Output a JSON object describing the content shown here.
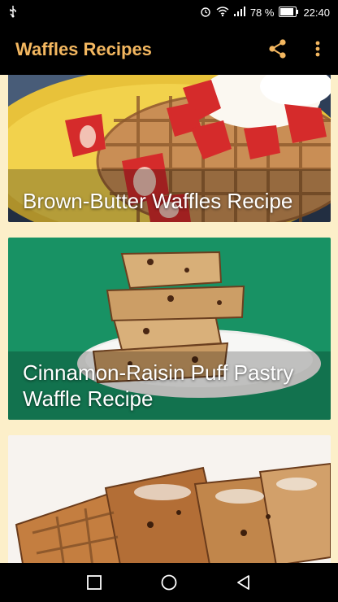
{
  "status": {
    "battery_percent": "78 %",
    "time": "22:40"
  },
  "app": {
    "title": "Waffles Recipes"
  },
  "recipes": [
    {
      "title": "Brown-Butter Waffles Recipe"
    },
    {
      "title": "Cinnamon-Raisin Puff Pastry Waffle Recipe"
    },
    {
      "title": ""
    }
  ],
  "icons": {
    "usb": "usb-icon",
    "alarm": "alarm-icon",
    "wifi": "wifi-icon",
    "signal": "signal-icon",
    "battery": "battery-icon",
    "share": "share-icon",
    "more": "more-vert-icon",
    "recents": "recents-icon",
    "home": "home-icon",
    "back": "back-icon"
  },
  "colors": {
    "accent": "#F3B760",
    "background": "#FCEFC9",
    "bars": "#000000"
  }
}
